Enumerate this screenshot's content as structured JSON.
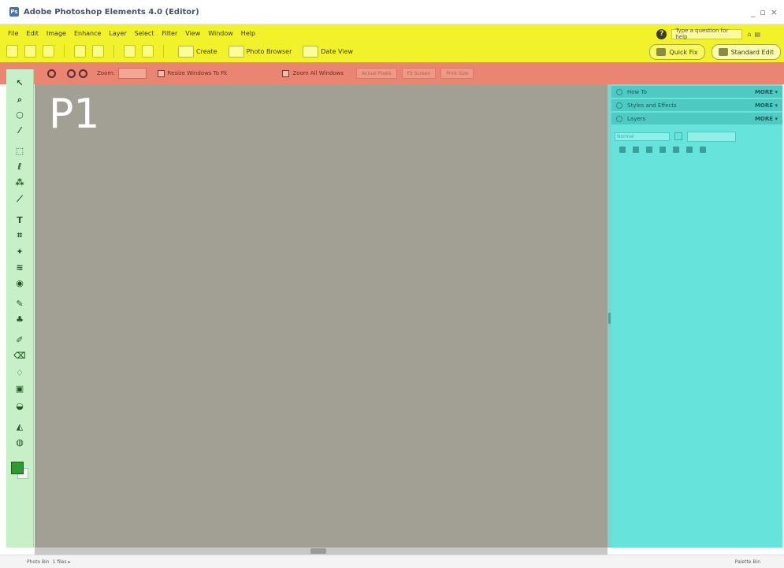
{
  "window": {
    "title": "Adobe Photoshop Elements 4.0 (Editor)",
    "app_icon": "photoshop-elements-icon",
    "controls": [
      "_",
      "▫",
      "×"
    ]
  },
  "menu": {
    "items": [
      "File",
      "Edit",
      "Image",
      "Enhance",
      "Layer",
      "Select",
      "Filter",
      "View",
      "Window",
      "Help"
    ]
  },
  "help": {
    "placeholder": "Type a question for help",
    "extras": [
      "⌂",
      "▤"
    ]
  },
  "toolbar": {
    "create_label": "Create",
    "photo_browser_label": "Photo Browser",
    "date_view_label": "Date View"
  },
  "mode_tabs": {
    "quick_fix": "Quick Fix",
    "standard_edit": "Standard Edit"
  },
  "options": {
    "zoom_label": "Zoom:",
    "resize_windows": "Resize Windows To Fit",
    "zoom_all_windows": "Zoom All Windows",
    "actual_pixels": "Actual Pixels",
    "fit_screen": "Fit Screen",
    "print_size": "Print Size"
  },
  "workspace": {
    "label": "P1"
  },
  "palettes": {
    "how_to": "How To",
    "styles_effects": "Styles and Effects",
    "layers": "Layers",
    "more": "MORE ▾",
    "blend_mode": "Normal"
  },
  "status": {
    "left_text": "Photo Bin",
    "file_text": "1 files ▸",
    "right_text": "Palette Bin"
  },
  "colors": {
    "menu_bg": "#f2f22a",
    "options_bg": "#e98570",
    "tools_bg": "#c8f0c8",
    "workspace_bg": "#a29f94",
    "palette_bg": "#66e3da"
  }
}
